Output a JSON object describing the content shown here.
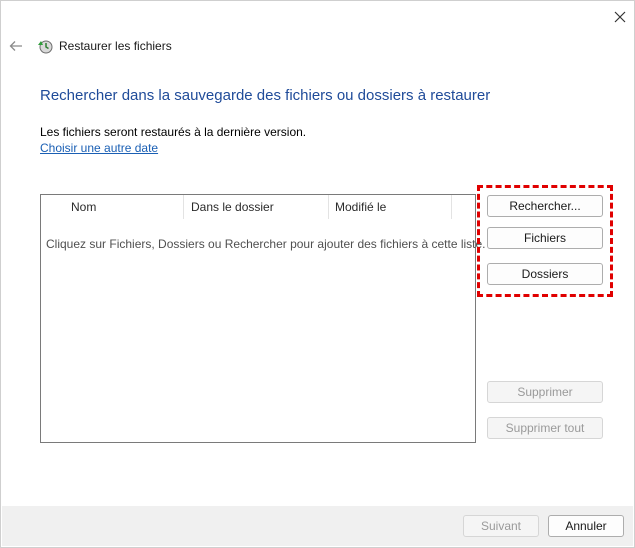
{
  "window": {
    "title": "Restaurer les fichiers"
  },
  "main": {
    "heading": "Rechercher dans la sauvegarde des fichiers ou dossiers à restaurer",
    "info": "Les fichiers seront restaurés à la dernière version.",
    "link": "Choisir une autre date"
  },
  "list": {
    "columns": [
      "Nom",
      "Dans le dossier",
      "Modifié le"
    ],
    "empty_message": "Cliquez sur Fichiers, Dossiers ou Rechercher pour ajouter des fichiers à cette liste."
  },
  "side_buttons": {
    "search": "Rechercher...",
    "files": "Fichiers",
    "folders": "Dossiers",
    "remove": "Supprimer",
    "remove_all": "Supprimer tout"
  },
  "footer": {
    "next": "Suivant",
    "cancel": "Annuler"
  },
  "colors": {
    "heading": "#1f4b99",
    "link": "#1a5fb4",
    "highlight": "#e00000"
  },
  "icons": {
    "close": "close-icon",
    "back": "back-arrow-icon",
    "app": "restore-files-icon"
  }
}
